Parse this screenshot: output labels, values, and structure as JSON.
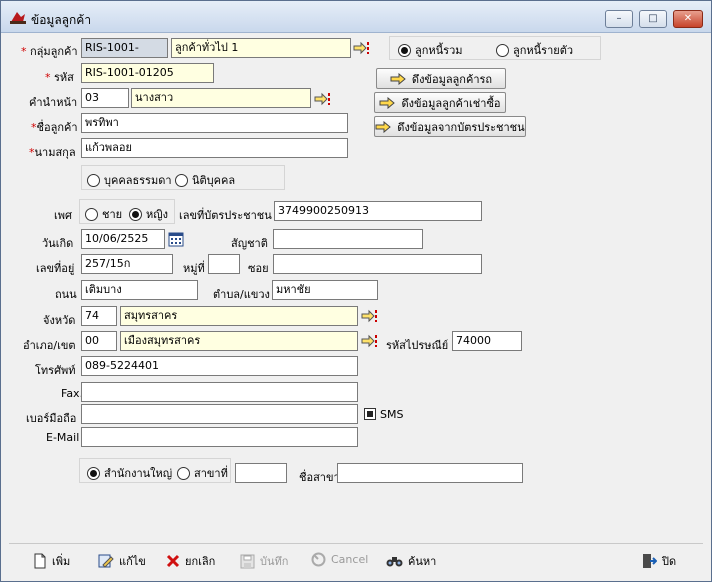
{
  "window": {
    "title": "ข้อมูลลูกค้า",
    "minimize": "–",
    "maximize": "□",
    "close": "✕"
  },
  "form": {
    "group_label": "กลุ่มลูกค้า",
    "group_code": "RIS-1001-",
    "group_name": "ลูกค้าทั่วไป 1",
    "code_label": "รหัส",
    "code_value": "RIS-1001-01205",
    "prefix_label": "คำนำหน้า",
    "prefix_code": "03",
    "prefix_name": "นางสาว",
    "firstname_label": "ชื่อลูกค้า",
    "firstname_value": "พรทิพา",
    "lastname_label": "นามสกุล",
    "lastname_value": "แก้วพลอย",
    "person_type": {
      "option1": "บุคคลธรรมดา",
      "option2": "นิติบุคคล",
      "selected": "none"
    },
    "sex_label": "เพศ",
    "sex_male": "ชาย",
    "sex_female": "หญิง",
    "sex_selected": "หญิง",
    "idcard_label": "เลขที่บัตรประชาชน",
    "idcard_value": "3749900250913",
    "birthdate_label": "วันเกิด",
    "birthdate_value": "10/06/2525",
    "nationality_label": "สัญชาติ",
    "nationality_value": "",
    "address_label": "เลขที่อยู่",
    "address_value": "257/15ก",
    "moo_label": "หมู่ที่",
    "moo_value": "",
    "soi_label": "ซอย",
    "soi_value": "",
    "road_label": "ถนน",
    "road_value": "เติมบาง",
    "subdistrict_label": "ตำบล/แขวง",
    "subdistrict_value": "มหาชัย",
    "province_label": "จังหวัด",
    "province_code": "74",
    "province_name": "สมุทรสาคร",
    "district_label": "อำเภอ/เขต",
    "district_code": "00",
    "district_name": "เมืองสมุทรสาคร",
    "postcode_label": "รหัสไปรษณีย์",
    "postcode_value": "74000",
    "phone_label": "โทรศัพท์",
    "phone_value": "089-5224401",
    "fax_label": "Fax.",
    "fax_value": "",
    "mobile_label": "เบอร์มือถือ",
    "mobile_value": "",
    "sms_label": "SMS",
    "email_label": "E-Mail",
    "email_value": "",
    "branch_head": "สำนักงานใหญ่",
    "branch_sub": "สาขาที่",
    "branch_no": "",
    "branch_name_label": "ชื่อสาขา",
    "branch_name_value": ""
  },
  "debtor": {
    "combined": "ลูกหนี้รวม",
    "individual": "ลูกหนี้รายตัว",
    "selected": "ลูกหนี้รวม"
  },
  "actions": {
    "pull_car": "ดึงข้อมูลลูกค้ารถ",
    "pull_hire": "ดึงข้อมูลลูกค้าเช่าซื้อ",
    "pull_idcard": "ดึงข้อมูลจากบัตรประชาชน"
  },
  "toolbar": {
    "add": "เพิ่ม",
    "edit": "แก้ไข",
    "cancel_item": "ยกเลิก",
    "save": "บันทึก",
    "cancel": "Cancel",
    "search": "ค้นหา",
    "close": "ปิด"
  },
  "colors": {
    "titlebar": "#c9d8ec",
    "yellow_field": "#ffffe1",
    "required": "#d00000"
  }
}
